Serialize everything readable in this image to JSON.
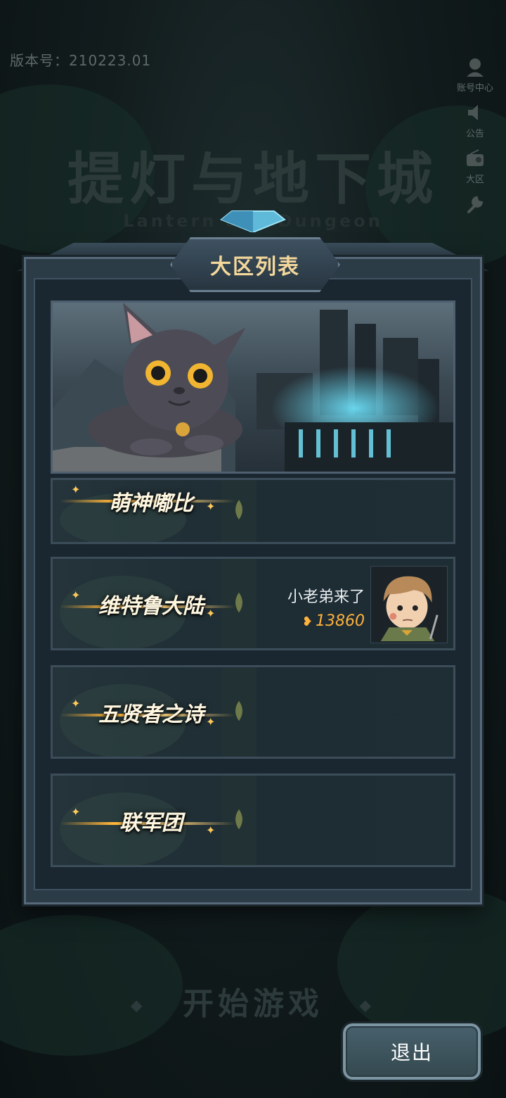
{
  "version": "版本号：210223.01",
  "side_menu": {
    "account": "账号中心",
    "notice": "公告",
    "region": "大区"
  },
  "game_title": "提灯与地下城",
  "game_subtitle": "Lantern and Dungeon",
  "dialog": {
    "title": "大区列表",
    "servers": [
      {
        "name": "萌神嘟比"
      },
      {
        "name": "维特鲁大陆",
        "character": {
          "name": "小老弟来了",
          "power": "13860"
        }
      },
      {
        "name": "五贤者之诗"
      },
      {
        "name": "联军团"
      }
    ]
  },
  "start_game": "开始游戏",
  "exit": "退出"
}
